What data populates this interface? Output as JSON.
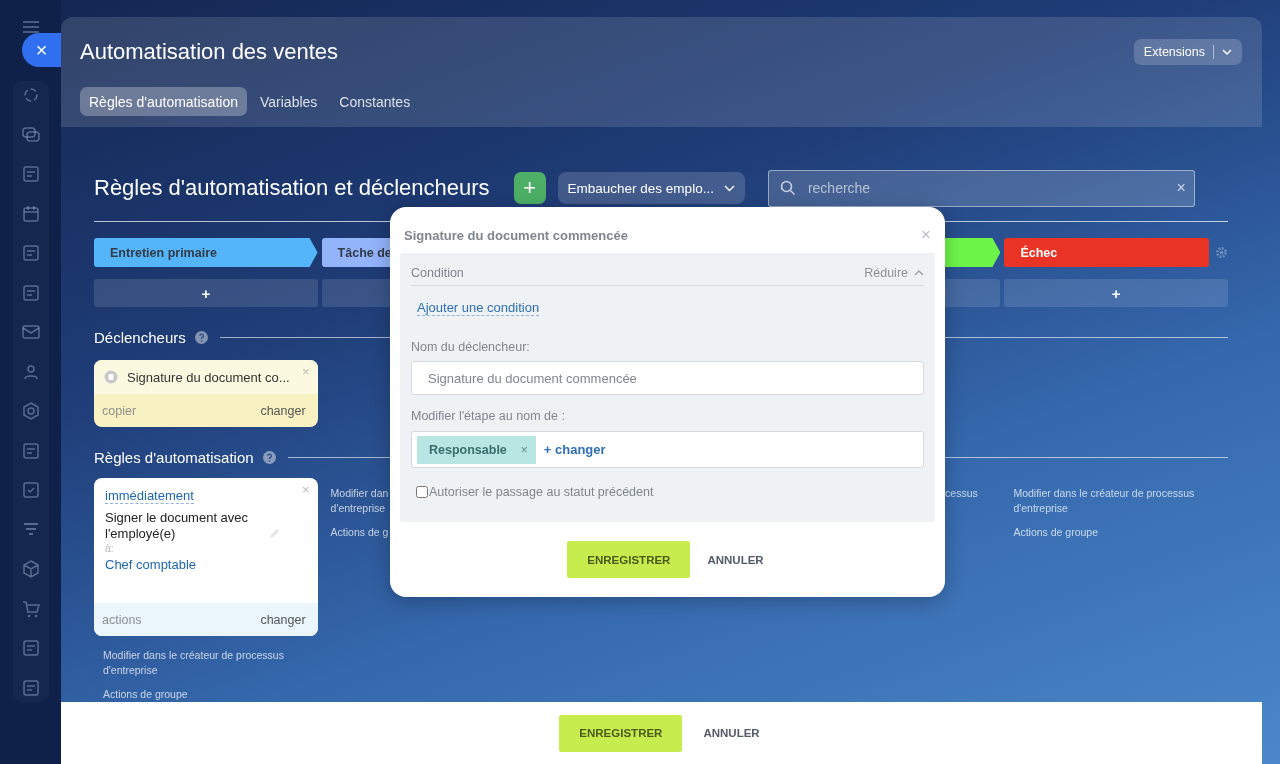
{
  "sidebar": {
    "close_label": "×"
  },
  "window": {
    "title": "Automatisation des ventes",
    "extensions_button": "Extensions"
  },
  "tabs": [
    {
      "label": "Règles d'automatisation",
      "selected": true
    },
    {
      "label": "Variables",
      "selected": false
    },
    {
      "label": "Constantes",
      "selected": false
    }
  ],
  "heading": {
    "title": "Règles d'automatisation et déclencheurs",
    "add_label": "+",
    "pipeline": "Embaucher des emplo...",
    "search_placeholder": "recherche",
    "search_clear": "×"
  },
  "stages": [
    {
      "label": "Entretien primaire",
      "color": "#55b5fb",
      "add_label": "+"
    },
    {
      "label": "Tâche de",
      "color": "#93b3fb"
    },
    {
      "color": "#6ef54a"
    },
    {
      "label": "Échec",
      "color": "#e93324",
      "add_label": "+"
    }
  ],
  "triggers_title": "Déclencheurs",
  "trigger_card": {
    "title": "Signature du document co...",
    "close": "×",
    "copy": "copier",
    "change": "changer"
  },
  "robots_title": "Règles d'automatisation",
  "robot_columns": [
    {
      "card": {
        "delay": "immédiatement",
        "close": "×",
        "name": "Signer le document avec l'employé(e)",
        "to_label": "à:",
        "assignee": "Chef comptable",
        "actions": "actions",
        "change": "changer"
      },
      "links": [
        {
          "lines": [
            "Modifier dans le créateur de processus",
            "d'entreprise"
          ]
        },
        {
          "lines": [
            "Actions de groupe"
          ]
        }
      ]
    },
    {
      "links": [
        {
          "lines": [
            "Modifier dan",
            "d'entreprise"
          ]
        },
        {
          "lines": [
            "Actions de g"
          ]
        }
      ]
    },
    {
      "kind": "cut_left",
      "links": [
        {
          "lines": [
            "cessus"
          ]
        }
      ]
    },
    {
      "links": [
        {
          "lines": [
            "Modifier dans le créateur de processus",
            "d'entreprise"
          ]
        },
        {
          "lines": [
            "Actions de groupe"
          ]
        }
      ]
    }
  ],
  "dialog": {
    "title": "Signature du document commencée",
    "close": "×",
    "condition_label": "Condition",
    "collapse": "Réduire",
    "add_condition": "Ajouter une condition",
    "name_label": "Nom du déclencheur:",
    "name_value": "Signature du document commencée",
    "assignee_label": "Modifier l'étape au nom de :",
    "chip": "Responsable",
    "chip_remove": "×",
    "change_link": "+ changer",
    "allow_back": {
      "label": "Autoriser le passage au statut précédent",
      "checked": false
    },
    "save": "ENREGISTRER",
    "cancel": "ANNULER"
  },
  "footer": {
    "save": "ENREGISTRER",
    "cancel": "ANNULER"
  }
}
